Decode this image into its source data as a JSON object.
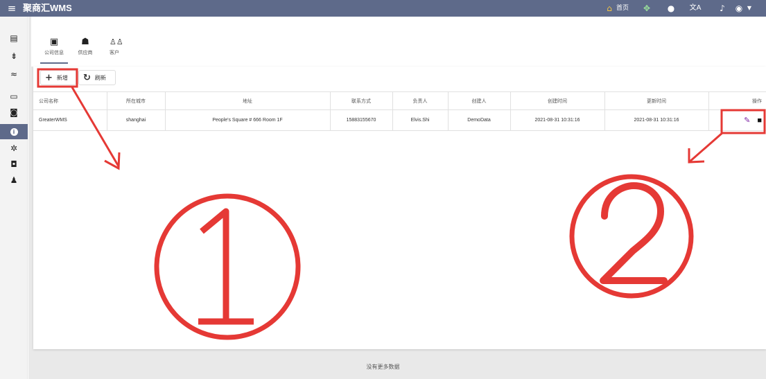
{
  "app": {
    "title": "聚商汇WMS"
  },
  "topbar": {
    "home_label": "首页"
  },
  "tabs": [
    {
      "label": "公司信息",
      "icon": "company-icon"
    },
    {
      "label": "供应商",
      "icon": "supplier-icon"
    },
    {
      "label": "客户",
      "icon": "customer-icon"
    }
  ],
  "toolbar": {
    "add_label": "新增",
    "refresh_label": "刷新"
  },
  "table": {
    "headers": [
      "公司名称",
      "所在城市",
      "地址",
      "联系方式",
      "负责人",
      "创建人",
      "创建时间",
      "更新时间",
      "操作"
    ],
    "rows": [
      [
        "GreaterWMS",
        "shanghai",
        "People's Square # 666 Room 1F",
        "15883155670",
        "Elvis.Shi",
        "DemoData",
        "2021-08-31 10:31:16",
        "2021-08-31 10:31:16"
      ]
    ]
  },
  "footer": {
    "message": "没有更多数据"
  },
  "annotations": [
    {
      "label": "①",
      "color": "#e53935"
    },
    {
      "label": "②",
      "color": "#e53935"
    }
  ],
  "colors": {
    "header": "#5e6a8a",
    "annotation": "#e53935",
    "edit": "#7b1fa2"
  }
}
